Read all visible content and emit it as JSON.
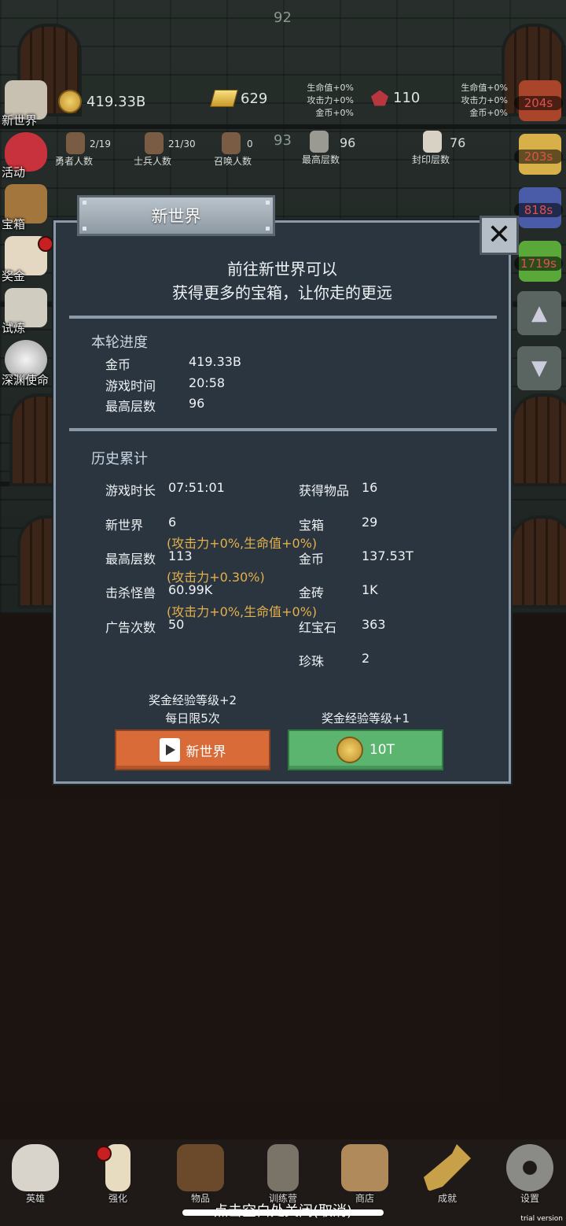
{
  "top_floor": "92",
  "mid_floor": "93",
  "resources": {
    "gold": "419.33B",
    "gold_bar": "629",
    "ruby": "110",
    "buff_left": [
      "生命值+0%",
      "攻击力+0%",
      "金币+0%"
    ],
    "buff_right": [
      "生命值+0%",
      "攻击力+0%",
      "金币+0%"
    ]
  },
  "stats": {
    "heroes": {
      "value": "2/19",
      "label": "勇者人数"
    },
    "soldiers": {
      "value": "21/30",
      "label": "士兵人数"
    },
    "summons": {
      "value": "0",
      "label": "召唤人数"
    },
    "max_floor": {
      "value": "96",
      "label": "最高层数"
    },
    "sealed": {
      "value": "76",
      "label": "封印层数"
    }
  },
  "side_menu": [
    "新世界",
    "活动",
    "宝箱",
    "奖金",
    "试炼",
    "深渊使命"
  ],
  "timers": [
    "204s",
    "203s",
    "818s",
    "1719s"
  ],
  "dialog": {
    "title": "新世界",
    "intro_line1": "前往新世界可以",
    "intro_line2": "获得更多的宝箱，让你走的更远",
    "current": {
      "title": "本轮进度",
      "rows": [
        {
          "label": "金币",
          "value": "419.33B"
        },
        {
          "label": "游戏时间",
          "value": "20:58"
        },
        {
          "label": "最高层数",
          "value": "96"
        }
      ]
    },
    "history": {
      "title": "历史累计",
      "left": [
        {
          "label": "游戏时长",
          "value": "07:51:01"
        },
        {
          "label": "新世界",
          "value": "6",
          "note": "(攻击力+0%,生命值+0%)"
        },
        {
          "label": "最高层数",
          "value": "113",
          "note": "(攻击力+0.30%)"
        },
        {
          "label": "击杀怪兽",
          "value": "60.99K",
          "note": "(攻击力+0%,生命值+0%)"
        },
        {
          "label": "广告次数",
          "value": "50"
        }
      ],
      "right": [
        {
          "label": "获得物品",
          "value": "16"
        },
        {
          "label": "宝箱",
          "value": "29"
        },
        {
          "label": "金币",
          "value": "137.53T"
        },
        {
          "label": "金砖",
          "value": "1K"
        },
        {
          "label": "红宝石",
          "value": "363"
        },
        {
          "label": "珍珠",
          "value": "2"
        }
      ]
    },
    "left_caption1": "奖金经验等级+2",
    "left_caption2": "每日限5次",
    "right_caption": "奖金经验等级+1",
    "btn_video_label": "新世界",
    "btn_coin_label": "10T"
  },
  "bottom_nav": [
    "英雄",
    "强化",
    "物品",
    "训练营",
    "商店",
    "成就",
    "设置"
  ],
  "close_hint": "点击空白处关闭(取消)",
  "trial": "trial version",
  "colors": {
    "panel": "#2b3540",
    "accent_note": "#e3b04b",
    "orange_btn": "#d86b38",
    "green_btn": "#5cb56e"
  }
}
